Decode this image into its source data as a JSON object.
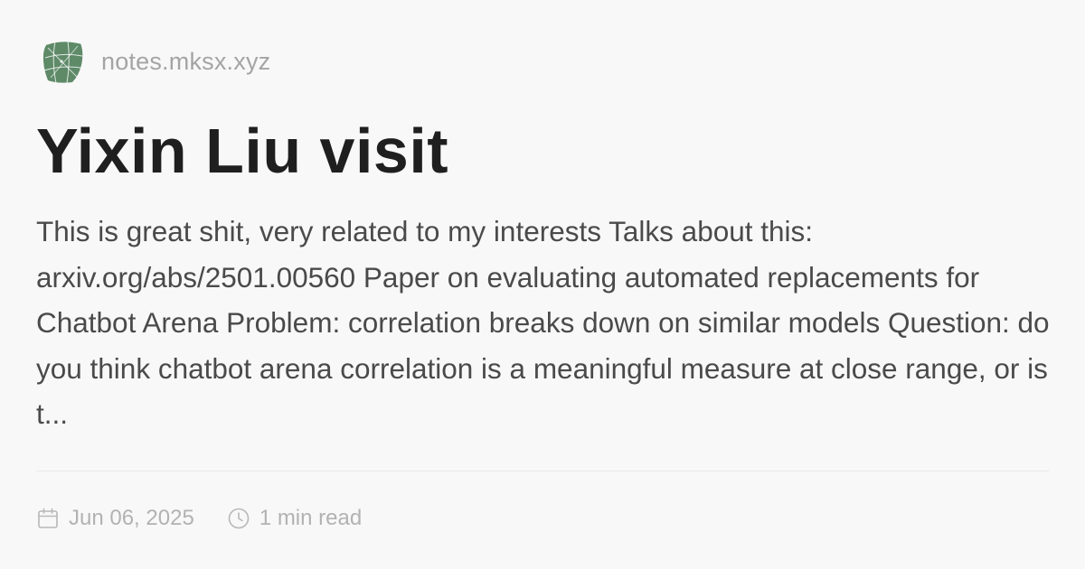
{
  "site": {
    "name": "notes.mksx.xyz",
    "logo_icon": "sphere-grid-logo-icon"
  },
  "post": {
    "title": "Yixin Liu visit",
    "excerpt": "This is great shit, very related to my interests Talks about this: arxiv.org/abs/2501.00560 Paper on evaluating automated replacements for Chatbot Arena Problem: correlation breaks down on similar models Question: do you think chatbot arena correlation is a meaningful measure at close range, or is t...",
    "date": "Jun 06, 2025",
    "date_icon": "calendar-icon",
    "read_time": "1 min read",
    "read_time_icon": "clock-icon"
  },
  "colors": {
    "background": "#f9f8f8",
    "title": "#1f1f1f",
    "excerpt": "#4a4a4a",
    "muted": "#a4a4a4",
    "logo_green": "#5e8a68"
  }
}
